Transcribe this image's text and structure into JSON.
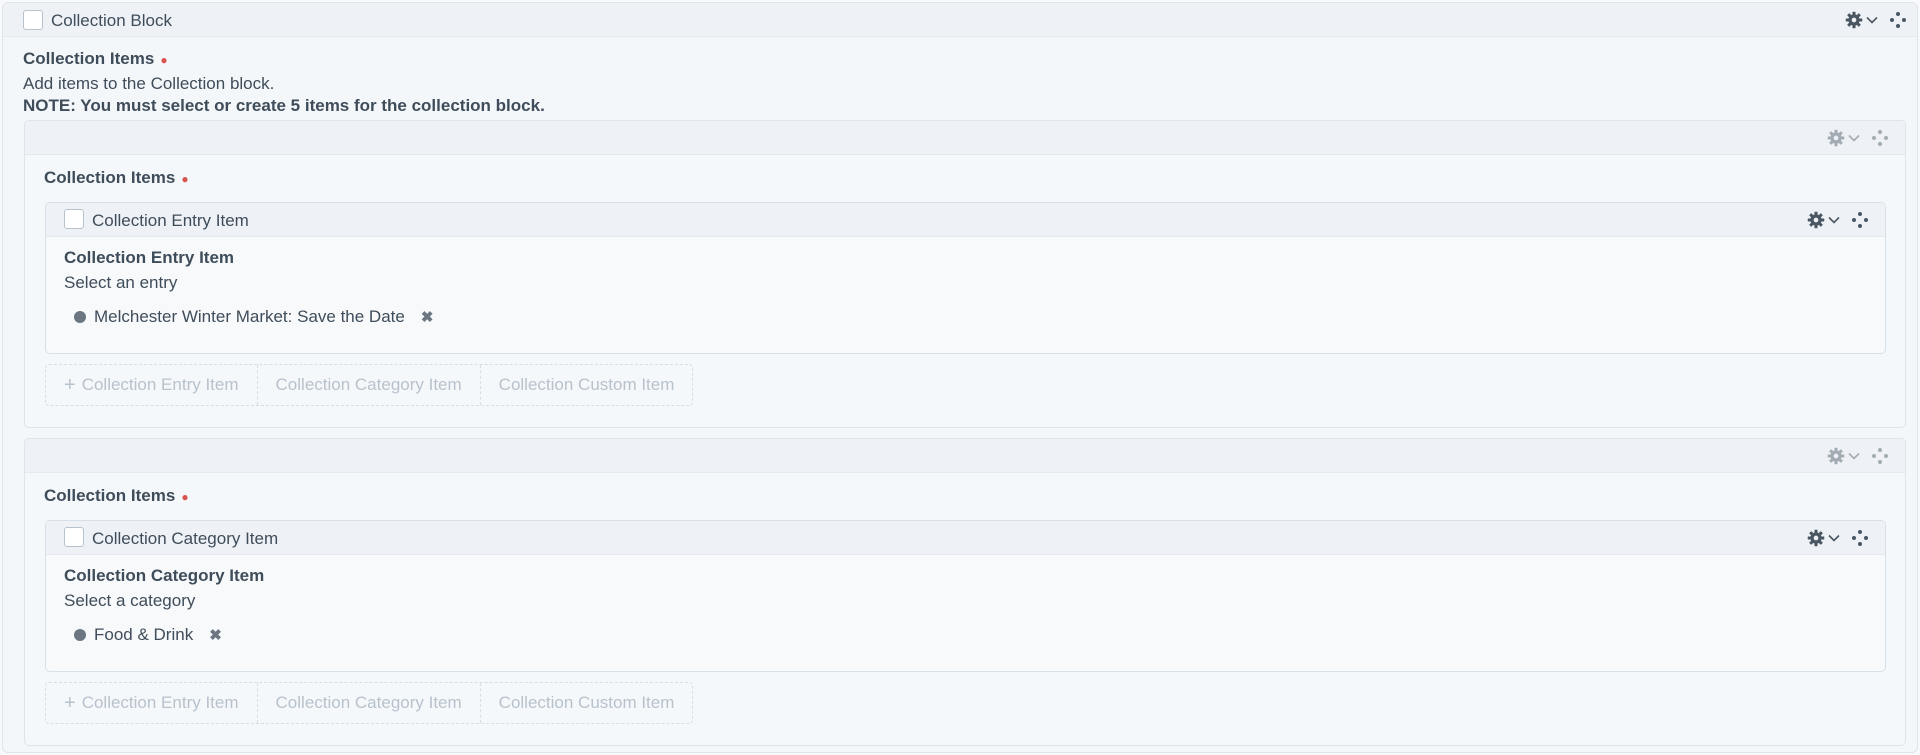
{
  "block": {
    "title": "Collection Block",
    "field_label": "Collection Items",
    "instructions": "Add items to the Collection block.",
    "note": "NOTE: You must select or create 5 items for the collection block."
  },
  "matrices": [
    {
      "field_label": "Collection Items",
      "entry": {
        "title": "Collection Entry Item",
        "field_label": "Collection Entry Item",
        "instructions": "Select an entry",
        "selected": "Melchester Winter Market: Save the Date"
      },
      "buttons": [
        "Collection Entry Item",
        "Collection Category Item",
        "Collection Custom Item"
      ]
    },
    {
      "field_label": "Collection Items",
      "entry": {
        "title": "Collection Category Item",
        "field_label": "Collection Category Item",
        "instructions": "Select a category",
        "selected": "Food & Drink"
      },
      "buttons": [
        "Collection Entry Item",
        "Collection Category Item",
        "Collection Custom Item"
      ]
    }
  ],
  "icons": {
    "settings": "gear-icon",
    "expand": "chevron-down-icon",
    "move": "move-icon",
    "remove": "remove-icon",
    "add": "plus-icon"
  },
  "colors": {
    "required": "#d9534f",
    "text": "#3f4d5a",
    "muted": "#b8c2cc"
  }
}
